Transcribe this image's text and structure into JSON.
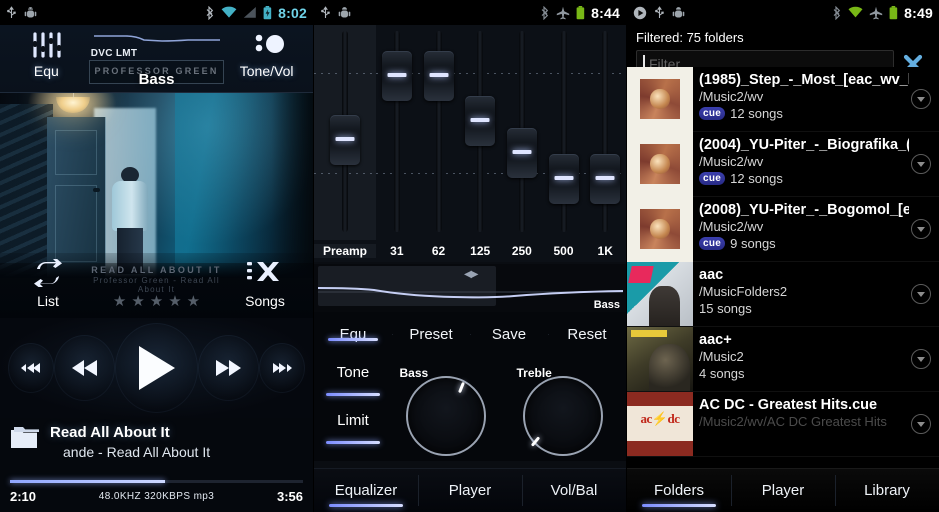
{
  "player": {
    "statusbar": {
      "icons": [
        "usb-icon",
        "android-debug-icon",
        "bluetooth-icon",
        "wifi-icon",
        "signal-icon",
        "battery-charging-icon"
      ],
      "clock": "8:02"
    },
    "top_buttons": [
      {
        "name": "equ",
        "label": "Equ",
        "icon": "equalizer-sliders-icon"
      },
      {
        "name": "tonevol",
        "label": "Tone/Vol",
        "icon": "tone-volume-icon"
      }
    ],
    "center": {
      "dvc_lmt": "DVC LMT",
      "artist_marquee": "PROFESSOR GREEN",
      "mode_label": "Bass"
    },
    "overlay": {
      "list_label": "List",
      "songs_label": "Songs",
      "track_marquee": "READ ALL ABOUT IT",
      "sub_marquee": "Professor Green - Read All About It",
      "stars": 5,
      "stars_filled": 0
    },
    "transport": {
      "prev_track": "skip-previous-icon",
      "rewind": "rewind-icon",
      "play": "play-icon",
      "fastforward": "fast-forward-icon",
      "next_track": "skip-next-icon"
    },
    "nowplaying": {
      "folder_icon": "folder-icon",
      "title": "Read All About It",
      "subtitle": "ande - Read All About It",
      "elapsed": "2:10",
      "format": "48.0KHZ  320KBPS  mp3",
      "duration": "3:56",
      "progress_percent": 53
    }
  },
  "equalizer": {
    "statusbar": {
      "icons": [
        "usb-icon",
        "android-debug-icon",
        "bluetooth-icon",
        "airplane-icon",
        "battery-icon"
      ],
      "clock": "8:44"
    },
    "bands": [
      {
        "label": "Preamp",
        "position": 42
      },
      {
        "label": "31",
        "position": 12
      },
      {
        "label": "62",
        "position": 12
      },
      {
        "label": "125",
        "position": 33
      },
      {
        "label": "250",
        "position": 48
      },
      {
        "label": "500",
        "position": 60
      },
      {
        "label": "1K",
        "position": 60
      }
    ],
    "curve": {
      "tooltip_arrows": "◀▶",
      "bass_label": "Bass"
    },
    "row_buttons": [
      {
        "label": "Equ",
        "selected": true
      },
      {
        "label": "Preset",
        "selected": false
      },
      {
        "label": "Save",
        "selected": false
      },
      {
        "label": "Reset",
        "selected": false
      }
    ],
    "side_buttons": [
      {
        "label": "Tone",
        "selected": true
      },
      {
        "label": "Limit",
        "selected": true
      }
    ],
    "knobs": [
      {
        "label": "Bass",
        "angle": 18
      },
      {
        "label": "Treble",
        "angle": -128
      }
    ],
    "tabs": [
      {
        "label": "Equalizer",
        "selected": true
      },
      {
        "label": "Player",
        "selected": false
      },
      {
        "label": "Vol/Bal",
        "selected": false
      }
    ]
  },
  "folders": {
    "statusbar": {
      "icons": [
        "play-status-icon",
        "usb-icon",
        "android-debug-icon",
        "bluetooth-icon",
        "wifi-icon",
        "airplane-icon",
        "battery-icon"
      ],
      "clock": "8:49"
    },
    "filtered_label": "Filtered: 75 folders",
    "filter_placeholder": "Filter",
    "filter_value": "",
    "clear_icon": "close-x-icon",
    "rows": [
      {
        "title": "(1985)_Step_-_Most_[eac_wv_l",
        "path": "/Music2/wv",
        "badge": "cue",
        "songs": "12 songs",
        "art": "art-cue",
        "bordered": true
      },
      {
        "title": "(2004)_YU-Piter_-_Biografika_(",
        "path": "/Music2/wv",
        "badge": "cue",
        "songs": "12 songs",
        "art": "art-cue",
        "bordered": true
      },
      {
        "title": "(2008)_YU-Piter_-_Bogomol_[e",
        "path": "/Music2/wv",
        "badge": "cue",
        "songs": "9 songs",
        "art": "art-cue",
        "bordered": true
      },
      {
        "title": "aac",
        "path": "/MusicFolders2",
        "badge": "",
        "songs": "15 songs",
        "art": "art-aac",
        "bordered": false
      },
      {
        "title": "aac+",
        "path": "/Music2",
        "badge": "",
        "songs": "4 songs",
        "art": "art-aacp",
        "bordered": false
      },
      {
        "title": "AC DC - Greatest Hits.cue",
        "path": "/Music2/wv/AC DC Greatest Hits",
        "badge": "",
        "songs": "",
        "art": "art-acdc",
        "bordered": false
      }
    ],
    "tabs": [
      {
        "label": "Folders",
        "selected": true
      },
      {
        "label": "Player",
        "selected": false
      },
      {
        "label": "Library",
        "selected": false
      }
    ]
  }
}
